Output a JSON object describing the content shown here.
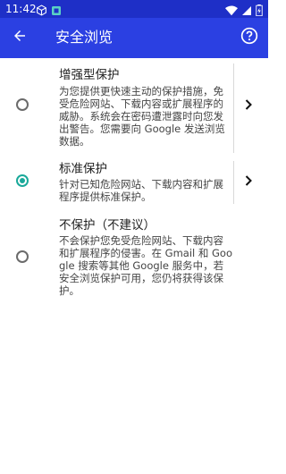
{
  "status_bar": {
    "time": "11:42",
    "icons_left": [
      "cube-icon",
      "app-notification-icon"
    ],
    "icons_right": [
      "wifi-icon",
      "signal-icon",
      "battery-icon"
    ]
  },
  "app_bar": {
    "title": "安全浏览",
    "back_icon": "arrow-back-icon",
    "help_icon": "help-icon",
    "color": "#2b40e2",
    "status_color": "#1e2fc7"
  },
  "options": [
    {
      "title": "增强型保护",
      "description": "为您提供更快速主动的保护措施，免受危险网站、下载内容或扩展程序的威胁。系统会在密码遭泄露时向您发出警告。您需要向 Google 发送浏览数据。",
      "selected": false,
      "has_details": true
    },
    {
      "title": "标准保护",
      "description": "针对已知危险网站、下载内容和扩展程序提供标准保护。",
      "selected": true,
      "has_details": true
    },
    {
      "title": "不保护（不建议）",
      "description": "不会保护您免受危险网站、下载内容和扩展程序的侵害。在 Gmail 和 Google 搜索等其他 Google 服务中，若安全浏览保护可用，您仍将获得该保护。",
      "selected": false,
      "has_details": false
    }
  ],
  "accent_color": "#1aa99a"
}
